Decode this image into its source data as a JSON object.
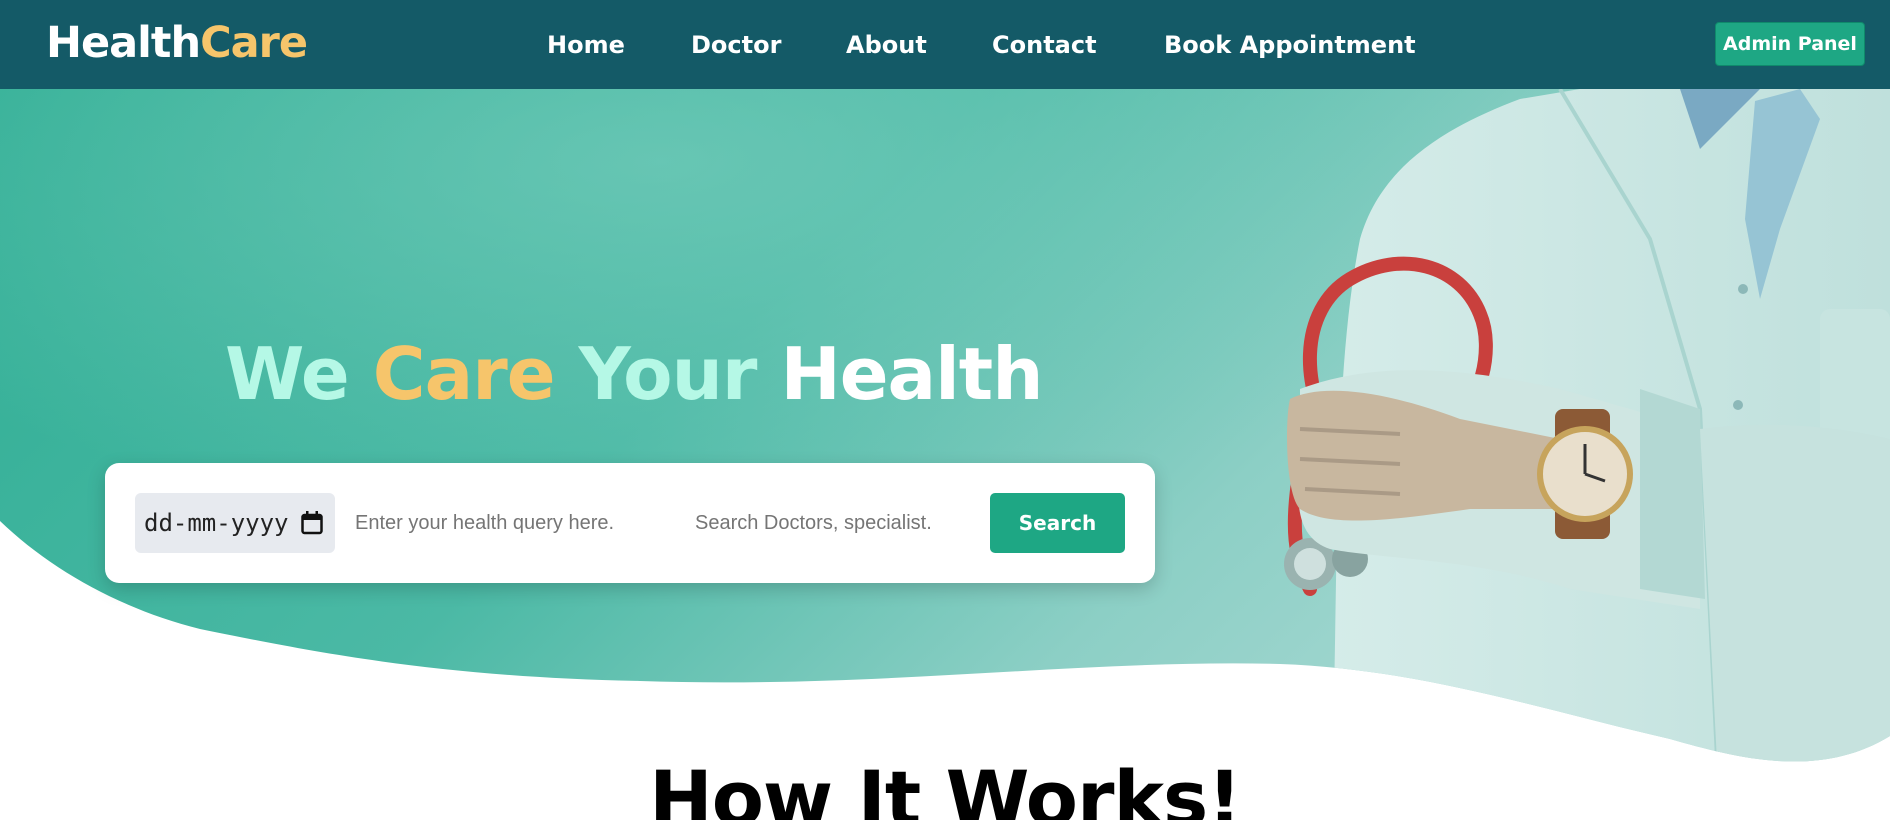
{
  "brand": {
    "part1": "Health",
    "part2": "Care"
  },
  "nav": {
    "home": "Home",
    "doctor": "Doctor",
    "about": "About",
    "contact": "Contact",
    "book": "Book Appointment"
  },
  "admin_label": "Admin Panel",
  "hero": {
    "title_word1": "We",
    "title_word2": "Care",
    "title_word3": "Your",
    "title_word4": "Health"
  },
  "search": {
    "date_value": "dd-mm-yyyy",
    "query_placeholder": "Enter your health query here.",
    "doctor_placeholder": "Search Doctors, specialist.",
    "button_label": "Search"
  },
  "section_title": "How It Works!",
  "colors": {
    "navbar": "#145a67",
    "accent_green": "#1ea784",
    "brand_yellow": "#f6c56b",
    "hero_mint": "#b5f8e6"
  },
  "icons": {
    "calendar": "calendar-icon"
  }
}
